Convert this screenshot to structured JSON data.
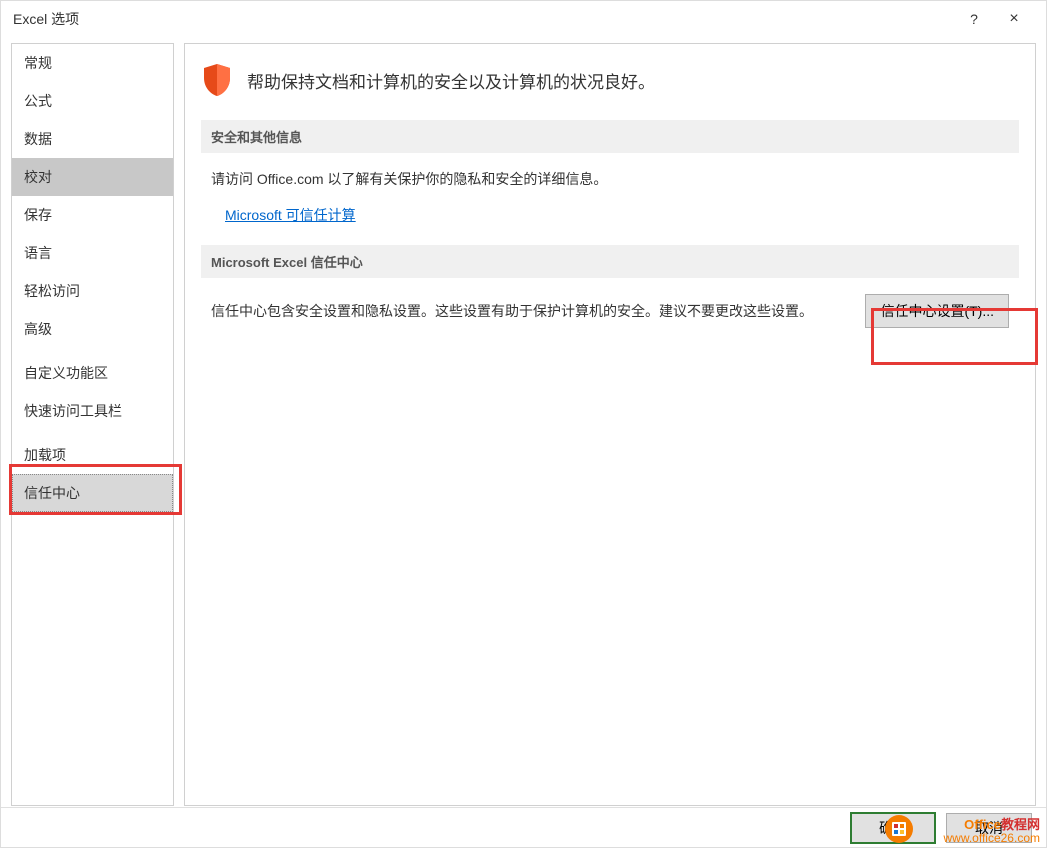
{
  "window": {
    "title": "Excel 选项",
    "help_symbol": "?",
    "close_symbol": "×"
  },
  "sidebar": {
    "items": [
      {
        "label": "常规"
      },
      {
        "label": "公式"
      },
      {
        "label": "数据"
      },
      {
        "label": "校对"
      },
      {
        "label": "保存"
      },
      {
        "label": "语言"
      },
      {
        "label": "轻松访问"
      },
      {
        "label": "高级"
      },
      {
        "label": "自定义功能区"
      },
      {
        "label": "快速访问工具栏"
      },
      {
        "label": "加载项"
      },
      {
        "label": "信任中心"
      }
    ]
  },
  "main": {
    "header_text": "帮助保持文档和计算机的安全以及计算机的状况良好。",
    "section1": {
      "title": "安全和其他信息",
      "body": "请访问 Office.com 以了解有关保护你的隐私和安全的详细信息。",
      "link": "Microsoft 可信任计算"
    },
    "section2": {
      "title": "Microsoft Excel 信任中心",
      "body": "信任中心包含安全设置和隐私设置。这些设置有助于保护计算机的安全。建议不要更改这些设置。",
      "button": "信任中心设置(T)..."
    }
  },
  "bottom": {
    "ok": "确定",
    "cancel": "取消"
  },
  "watermark": {
    "text_office": "Office",
    "text_suffix": "教程网",
    "url": "www.office26.com"
  }
}
